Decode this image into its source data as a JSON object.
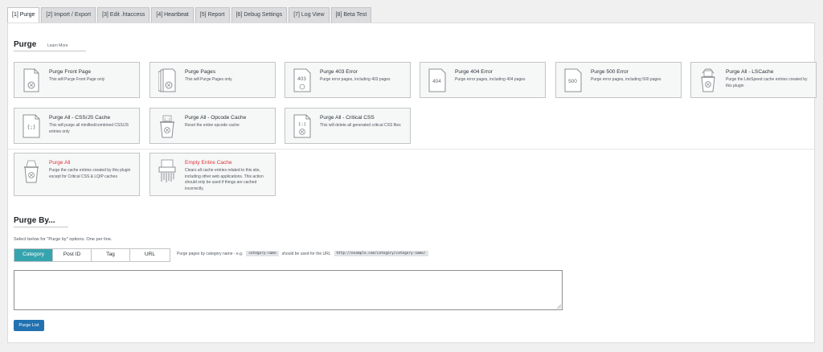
{
  "tabs": [
    {
      "label": "[1] Purge",
      "active": true
    },
    {
      "label": "[2] Import / Export"
    },
    {
      "label": "[3] Edit .htaccess"
    },
    {
      "label": "[4] Heartbeat"
    },
    {
      "label": "[5] Report"
    },
    {
      "label": "[6] Debug Settings"
    },
    {
      "label": "[7] Log View"
    },
    {
      "label": "[8] Beta Test"
    }
  ],
  "purge": {
    "title": "Purge",
    "learn_more": "Learn More",
    "cards": [
      {
        "title": "Purge Front Page",
        "desc": "This will Purge Front Page only",
        "icon": "page-icon"
      },
      {
        "title": "Purge Pages",
        "desc": "This will Purge Pages only",
        "icon": "pages-icon"
      },
      {
        "title": "Purge 403 Error",
        "desc": "Purge error pages, including 403 pages",
        "icon": "error-403-icon",
        "code": "403"
      },
      {
        "title": "Purge 404 Error",
        "desc": "Purge error pages, including 404 pages",
        "icon": "error-404-icon",
        "code": "404"
      },
      {
        "title": "Purge 500 Error",
        "desc": "Purge error pages, including 500 pages",
        "icon": "error-500-icon",
        "code": "500"
      },
      {
        "title": "Purge All - LSCache",
        "desc": "Purge the LiteSpeed cache entries created by this plugin",
        "icon": "lscache-icon"
      },
      {
        "title": "Purge All - CSS/JS Cache",
        "desc": "This will purge all minified/combined CSS/JS entries only",
        "icon": "cssjs-icon"
      },
      {
        "title": "Purge All - Opcode Cache",
        "desc": "Reset the entire opcode cache",
        "icon": "opcode-icon"
      },
      {
        "title": "Purge All - Critical CSS",
        "desc": "This will delete all generated critical CSS files",
        "icon": "critical-css-icon"
      }
    ],
    "danger_cards": [
      {
        "title": "Purge All",
        "desc": "Purge the cache entries created by this plugin except for Critical CSS & LQIP caches",
        "icon": "purge-all-icon"
      },
      {
        "title": "Empty Entire Cache",
        "desc": "Clears all cache entries related to this site, including other web applications. This action should only be used if things are cached incorrectly.",
        "icon": "shredder-icon"
      }
    ]
  },
  "purge_by": {
    "title": "Purge By...",
    "hint": "Select below for \"Purge by\" options. One per line.",
    "options": [
      "Category",
      "Post ID",
      "Tag",
      "URL"
    ],
    "selected": "Category",
    "note_prefix": "Purge pages by category name - e.g.",
    "note_code1": "category-name",
    "note_middle": "should be used for the URL",
    "note_code2": "http://example.com/category/category-name/",
    "textarea_value": "",
    "button_label": "Purge List"
  },
  "colors": {
    "accent": "#36a4ae",
    "primary": "#2271b1",
    "danger": "#d63638"
  }
}
